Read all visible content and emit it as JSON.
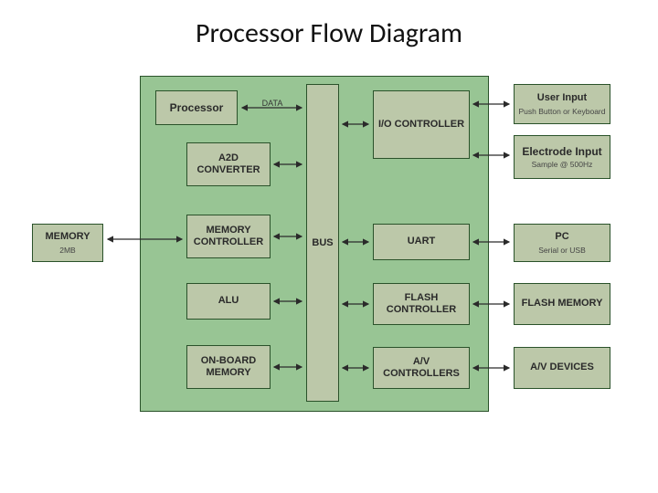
{
  "title": "Processor Flow Diagram",
  "blocks": {
    "memory": {
      "label": "MEMORY",
      "sub": "2MB"
    },
    "processor": {
      "label": "Processor"
    },
    "a2d": {
      "label": "A2D CONVERTER"
    },
    "memctrl": {
      "label": "MEMORY CONTROLLER"
    },
    "alu": {
      "label": "ALU"
    },
    "onboard": {
      "label": "ON-BOARD MEMORY"
    },
    "bus": {
      "label": "BUS"
    },
    "ioctrl": {
      "label": "I/O CONTROLLER"
    },
    "uart": {
      "label": "UART"
    },
    "flashctrl": {
      "label": "FLASH CONTROLLER"
    },
    "avctrl": {
      "label": "A/V CONTROLLERS"
    },
    "userinput": {
      "label": "User Input",
      "sub": "Push Button or Keyboard"
    },
    "electrode": {
      "label": "Electrode Input",
      "sub": "Sample @ 500Hz"
    },
    "pc": {
      "label": "PC",
      "sub": "Serial or USB"
    },
    "flashmem": {
      "label": "FLASH MEMORY"
    },
    "avdev": {
      "label": "A/V DEVICES"
    }
  },
  "labels": {
    "data": "DATA"
  }
}
